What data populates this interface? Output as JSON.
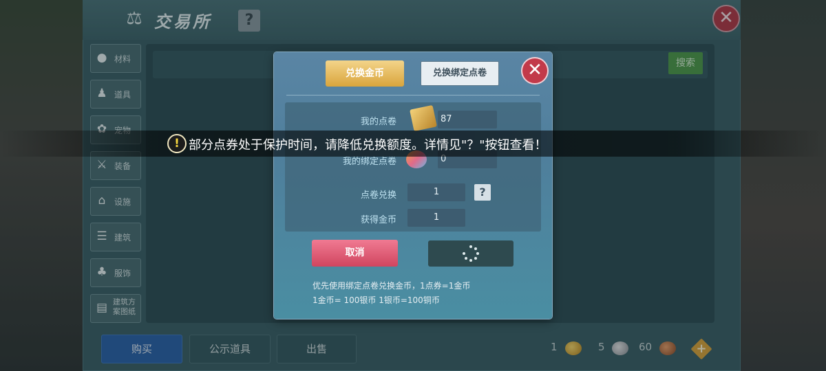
{
  "window": {
    "title": "交易所",
    "help_label": "?",
    "close_label": "✕"
  },
  "sidebar": {
    "items": [
      {
        "label": "材料",
        "icon": "ore-icon"
      },
      {
        "label": "道具",
        "icon": "chess-piece-icon"
      },
      {
        "label": "宠物",
        "icon": "paw-icon"
      },
      {
        "label": "装备",
        "icon": "sword-shield-icon"
      },
      {
        "label": "设施",
        "icon": "facility-icon"
      },
      {
        "label": "建筑",
        "icon": "building-icon"
      },
      {
        "label": "服饰",
        "icon": "clothing-icon"
      },
      {
        "label": "建筑方\n案图纸",
        "icon": "blueprint-icon"
      }
    ]
  },
  "search": {
    "button_label": "搜索"
  },
  "bottom_tabs": [
    {
      "label": "购买",
      "active": true
    },
    {
      "label": "公示道具",
      "active": false
    },
    {
      "label": "出售",
      "active": false
    }
  ],
  "currencies": {
    "gold": "1",
    "silver": "5",
    "copper": "60",
    "add_label": "+"
  },
  "modal": {
    "tab_gold": "兑换金币",
    "tab_bound": "兑换绑定点卷",
    "close_label": "✕",
    "my_points_label": "我的点卷",
    "my_points_value": "87",
    "my_bound_label": "我的绑定点卷",
    "my_bound_value": "0",
    "exchange_label": "点卷兑换",
    "exchange_value": "1",
    "exchange_help": "?",
    "gain_label": "获得金币",
    "gain_value": "1",
    "cancel_label": "取消",
    "note_line1": "优先使用绑定点卷兑换金币，1点券=1金币",
    "note_line2": "1金币= 100银币  1银币=100铜币"
  },
  "toast": {
    "icon": "!",
    "text": "部分点券处于保护时间，请降低兑换额度。详情见\"？\"按钮查看！"
  },
  "colors": {
    "gold_button": "#d9a53c",
    "cancel_button": "#d0455f",
    "close_red": "#c23a4a",
    "active_tab": "#2c63a8"
  }
}
